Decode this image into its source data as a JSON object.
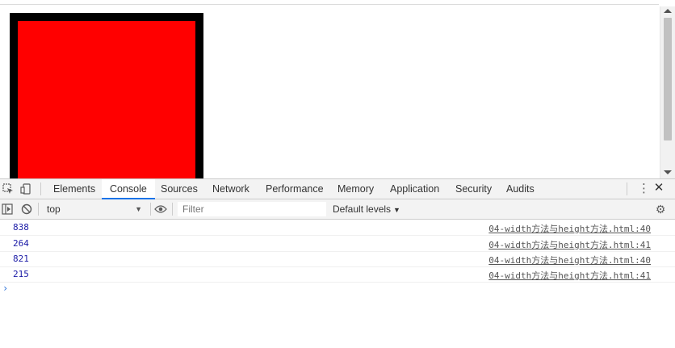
{
  "devtools": {
    "tabs": [
      "Elements",
      "Console",
      "Sources",
      "Network",
      "Performance",
      "Memory",
      "Application",
      "Security",
      "Audits"
    ],
    "active_tab": "Console",
    "toolbar": {
      "context": "top",
      "filter_placeholder": "Filter",
      "levels_label": "Default levels"
    },
    "console_rows": [
      {
        "value": "838",
        "source": "04-width方法与height方法.html:40"
      },
      {
        "value": "264",
        "source": "04-width方法与height方法.html:41"
      },
      {
        "value": "821",
        "source": "04-width方法与height方法.html:40"
      },
      {
        "value": "215",
        "source": "04-width方法与height方法.html:41"
      }
    ],
    "prompt_symbol": "›"
  },
  "colors": {
    "demo_fill": "#ff0000",
    "demo_border": "#000000",
    "log_value": "#1a1aa6",
    "active_tab_underline": "#1a73e8"
  },
  "icons": [
    "inspect-element-icon",
    "device-toolbar-icon",
    "more-options-icon",
    "close-icon",
    "sidebar-toggle-icon",
    "clear-console-icon",
    "eye-icon",
    "settings-gear-icon"
  ]
}
